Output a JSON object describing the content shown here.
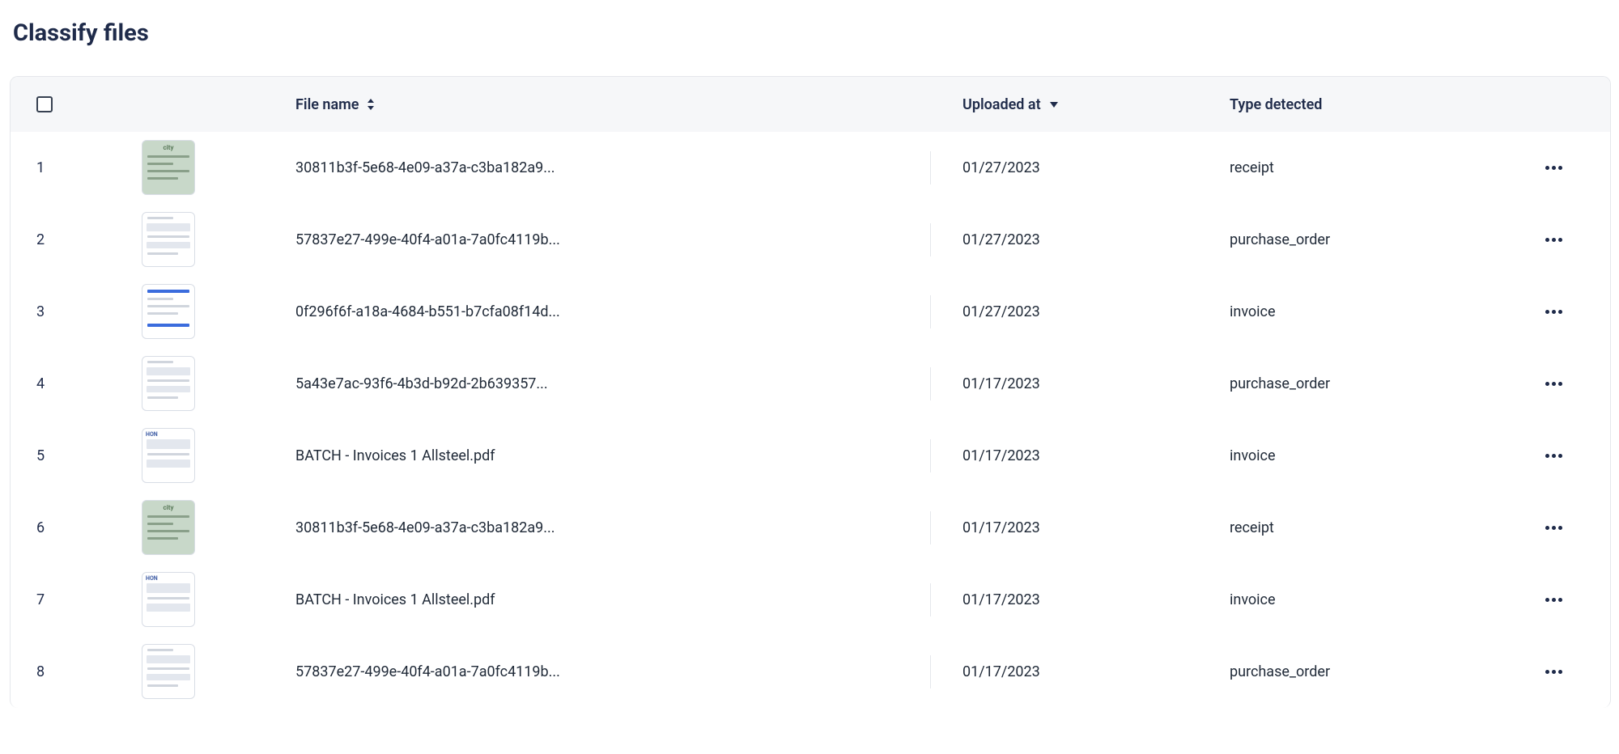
{
  "page_title": "Classify files",
  "columns": {
    "file_name": "File name",
    "uploaded_at": "Uploaded at",
    "type_detected": "Type detected"
  },
  "rows": [
    {
      "index": "1",
      "file_name": "30811b3f-5e68-4e09-a37a-c3ba182a9...",
      "uploaded_at": "01/27/2023",
      "type_detected": "receipt",
      "thumb": "receipt"
    },
    {
      "index": "2",
      "file_name": "57837e27-499e-40f4-a01a-7a0fc4119b...",
      "uploaded_at": "01/27/2023",
      "type_detected": "purchase_order",
      "thumb": "form"
    },
    {
      "index": "3",
      "file_name": "0f296f6f-a18a-4684-b551-b7cfa08f14d...",
      "uploaded_at": "01/27/2023",
      "type_detected": "invoice",
      "thumb": "invoice_blue"
    },
    {
      "index": "4",
      "file_name": "5a43e7ac-93f6-4b3d-b92d-2b639357...",
      "uploaded_at": "01/17/2023",
      "type_detected": "purchase_order",
      "thumb": "form"
    },
    {
      "index": "5",
      "file_name": "BATCH - Invoices 1 Allsteel.pdf",
      "uploaded_at": "01/17/2023",
      "type_detected": "invoice",
      "thumb": "hon"
    },
    {
      "index": "6",
      "file_name": "30811b3f-5e68-4e09-a37a-c3ba182a9...",
      "uploaded_at": "01/17/2023",
      "type_detected": "receipt",
      "thumb": "receipt"
    },
    {
      "index": "7",
      "file_name": "BATCH - Invoices 1 Allsteel.pdf",
      "uploaded_at": "01/17/2023",
      "type_detected": "invoice",
      "thumb": "hon"
    },
    {
      "index": "8",
      "file_name": "57837e27-499e-40f4-a01a-7a0fc4119b...",
      "uploaded_at": "01/17/2023",
      "type_detected": "purchase_order",
      "thumb": "form"
    }
  ]
}
